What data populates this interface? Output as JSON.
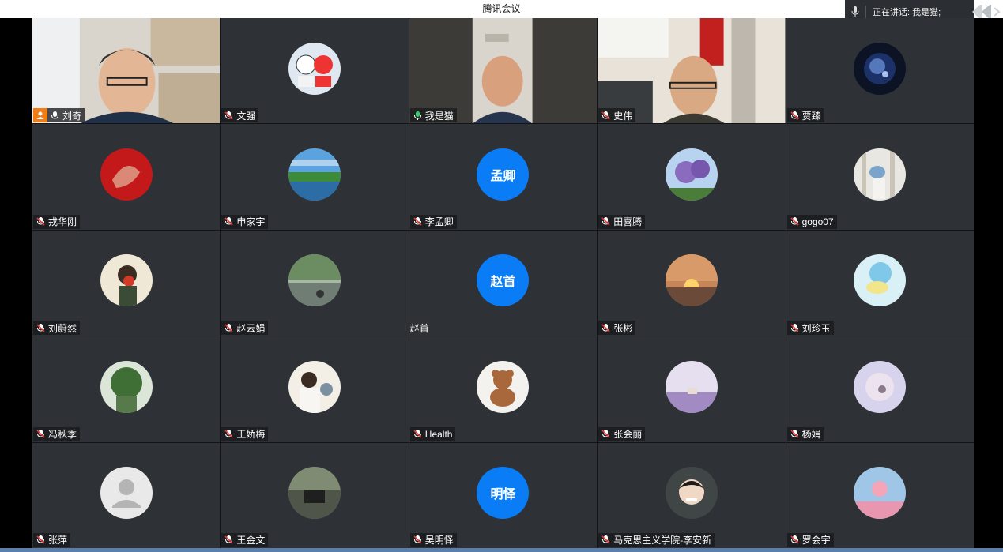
{
  "window": {
    "title": "腾讯会议"
  },
  "speaking_panel": {
    "text": "正在讲话: 我是猫;"
  },
  "participants": [
    {
      "name": "刘奇",
      "type": "video",
      "mic": "on",
      "host": true
    },
    {
      "name": "文强",
      "type": "image",
      "mic": "muted"
    },
    {
      "name": "我是猫",
      "type": "video",
      "mic": "speaking"
    },
    {
      "name": "史伟",
      "type": "video",
      "mic": "muted"
    },
    {
      "name": "贾臻",
      "type": "image",
      "mic": "muted"
    },
    {
      "name": "戎华刚",
      "type": "image",
      "mic": "muted"
    },
    {
      "name": "申家宇",
      "type": "image",
      "mic": "muted"
    },
    {
      "name": "李孟卿",
      "type": "text",
      "avatar_text": "孟卿",
      "mic": "muted"
    },
    {
      "name": "田喜腾",
      "type": "image",
      "mic": "muted"
    },
    {
      "name": "gogo07",
      "type": "image",
      "mic": "muted"
    },
    {
      "name": "刘蔚然",
      "type": "image",
      "mic": "muted"
    },
    {
      "name": "赵云娟",
      "type": "image",
      "mic": "muted"
    },
    {
      "name": "赵首",
      "type": "text",
      "avatar_text": "赵首",
      "mic": "none"
    },
    {
      "name": "张彬",
      "type": "image",
      "mic": "muted"
    },
    {
      "name": "刘珍玉",
      "type": "image",
      "mic": "muted"
    },
    {
      "name": "冯秋季",
      "type": "image",
      "mic": "muted"
    },
    {
      "name": "王娇梅",
      "type": "image",
      "mic": "muted"
    },
    {
      "name": "Health",
      "type": "image",
      "mic": "muted"
    },
    {
      "name": "张会丽",
      "type": "image",
      "mic": "muted"
    },
    {
      "name": "杨娟",
      "type": "image",
      "mic": "muted"
    },
    {
      "name": "张萍",
      "type": "default",
      "mic": "muted"
    },
    {
      "name": "王金文",
      "type": "image",
      "mic": "muted"
    },
    {
      "name": "吴明怿",
      "type": "text",
      "avatar_text": "明怿",
      "mic": "muted"
    },
    {
      "name": "马克思主义学院-李安新",
      "type": "image",
      "mic": "muted"
    },
    {
      "name": "罗会宇",
      "type": "image",
      "mic": "muted"
    }
  ],
  "colors": {
    "tile_bg": "#2e3135",
    "text_avatar_bg": "#0a7cf5",
    "host_badge": "#f07d16",
    "speaking_border": "#2db84d"
  }
}
